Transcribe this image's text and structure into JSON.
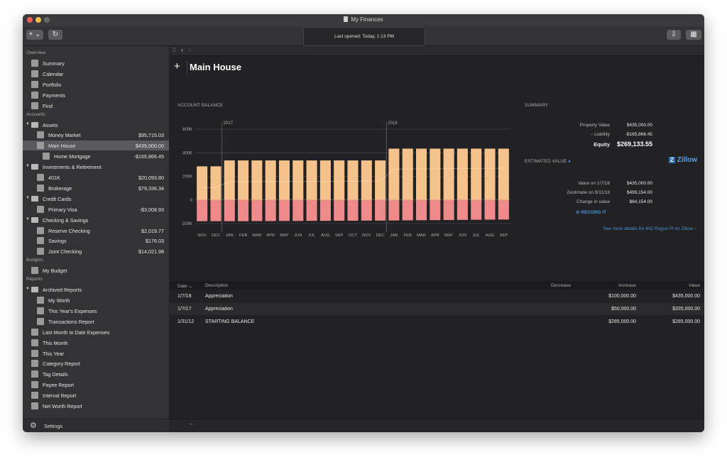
{
  "window": {
    "title": "My Finances",
    "status": "Last opened: Today, 1:13 PM"
  },
  "sidebar": {
    "overview_label": "Overview",
    "overview": [
      {
        "label": "Summary",
        "icon": "bank-icon"
      },
      {
        "label": "Calendar",
        "icon": "calendar-icon"
      },
      {
        "label": "Portfolio",
        "icon": "chart-icon"
      },
      {
        "label": "Payments",
        "icon": "payments-icon"
      },
      {
        "label": "Find",
        "icon": "search-icon"
      }
    ],
    "accounts_label": "Accounts",
    "accounts": [
      {
        "label": "Assets",
        "value": "",
        "level": 0,
        "group": true
      },
      {
        "label": "Money Market",
        "value": "$95,715.03",
        "level": 1
      },
      {
        "label": "Main House",
        "value": "$435,000.00",
        "level": 1,
        "selected": true
      },
      {
        "label": "Home Mortgage",
        "value": "-$165,866.45",
        "level": 2
      },
      {
        "label": "Investments & Retirement",
        "value": "",
        "level": 0,
        "group": true
      },
      {
        "label": "401K",
        "value": "$20,093.80",
        "level": 1
      },
      {
        "label": "Brokerage",
        "value": "$79,336.34",
        "level": 1
      },
      {
        "label": "Credit Cards",
        "value": "",
        "level": 0,
        "group": true
      },
      {
        "label": "Primary Visa",
        "value": "-$3,008.93",
        "level": 1
      },
      {
        "label": "Checking & Savings",
        "value": "",
        "level": 0,
        "group": true
      },
      {
        "label": "Reserve Checking",
        "value": "$2,019.77",
        "level": 1
      },
      {
        "label": "Savings",
        "value": "$176.03",
        "level": 1
      },
      {
        "label": "Joint Checking",
        "value": "$14,021.98",
        "level": 1
      }
    ],
    "budgets_label": "Budgets",
    "budgets": [
      {
        "label": "My Budget"
      }
    ],
    "reports_label": "Reports",
    "reports": [
      {
        "label": "Archived Reports",
        "level": 0,
        "group": true
      },
      {
        "label": "My Worth",
        "level": 1
      },
      {
        "label": "This Year's Expenses",
        "level": 1
      },
      {
        "label": "Transactions Report",
        "level": 1
      },
      {
        "label": "Last Month to Date Expenses",
        "level": 0
      },
      {
        "label": "This Month",
        "level": 0
      },
      {
        "label": "This Year",
        "level": 0
      },
      {
        "label": "Category Report",
        "level": 0
      },
      {
        "label": "Tag Details",
        "level": 0
      },
      {
        "label": "Payee Report",
        "level": 0
      },
      {
        "label": "Interval Report",
        "level": 0
      },
      {
        "label": "Net Worth Report",
        "level": 0
      }
    ],
    "settings_label": "Settings"
  },
  "main": {
    "title": "Main House",
    "balance_label": "ACCOUNT BALANCE",
    "summary_label": "SUMMARY",
    "summary": [
      {
        "k": "Property Value",
        "v": "$435,000.00"
      },
      {
        "k": "– Liability",
        "v": "-$165,866.45"
      },
      {
        "k": "Equity",
        "v": "$269,133.55"
      }
    ],
    "estimated_label": "ESTIMATED VALUE",
    "zillow_label": "Zillow",
    "estimated": [
      {
        "k": "Value on 1/7/18",
        "v": "$435,000.00"
      },
      {
        "k": "Zestimate on 9/11/18",
        "v": "$499,154.00"
      },
      {
        "k": "Change in value",
        "v": "$64,154.00"
      }
    ],
    "record_label": "⊕ RECORD IT",
    "zillow_link": "See more details for 442 Rogue Pl on Zillow ›",
    "table": {
      "headers": {
        "date": "Date ⌄",
        "description": "Description",
        "decrease": "Decrease",
        "increase": "Increase",
        "value": "Value"
      },
      "rows": [
        {
          "date": "1/7/18",
          "description": "Appreciation",
          "decrease": "",
          "increase": "$100,000.00",
          "value": "$435,000.00"
        },
        {
          "date": "1/7/17",
          "description": "Appreciation",
          "decrease": "",
          "increase": "$50,000.00",
          "value": "$335,000.00"
        },
        {
          "date": "1/31/12",
          "description": "STARTING BALANCE",
          "decrease": "",
          "increase": "$285,000.00",
          "value": "$285,000.00"
        }
      ]
    },
    "footer": "--"
  },
  "chart_data": {
    "type": "bar",
    "categories": [
      "NOV",
      "DEC",
      "JAN",
      "FEB",
      "MAR",
      "APR",
      "MAY",
      "JUN",
      "JUL",
      "AUG",
      "SEP",
      "OCT",
      "NOV",
      "DEC",
      "JAN",
      "FEB",
      "MAR",
      "APR",
      "MAY",
      "JUN",
      "JUL",
      "AUG",
      "SEP"
    ],
    "series": [
      {
        "values": [
          285000,
          285000,
          335000,
          335000,
          335000,
          335000,
          335000,
          335000,
          335000,
          335000,
          335000,
          335000,
          335000,
          335000,
          435000,
          435000,
          435000,
          435000,
          435000,
          435000,
          435000,
          435000,
          435000
        ]
      },
      {
        "values": [
          -180000,
          -180000,
          -180000,
          -180000,
          -179000,
          -179000,
          -178000,
          -178000,
          -177000,
          -177000,
          -176000,
          -176000,
          -175000,
          -175000,
          -174000,
          -173000,
          -172000,
          -171000,
          -170000,
          -169000,
          -168000,
          -167000,
          -166000
        ]
      }
    ],
    "year_markers": [
      {
        "label": "2017",
        "index": 2
      },
      {
        "label": "2018",
        "index": 14
      }
    ],
    "yticks": [
      "600K",
      "400K",
      "200K",
      "0",
      "-200K"
    ],
    "ylim": [
      -200000,
      600000
    ],
    "colors": {
      "asset": "#f6c28b",
      "liability": "#ee8a8a"
    }
  }
}
